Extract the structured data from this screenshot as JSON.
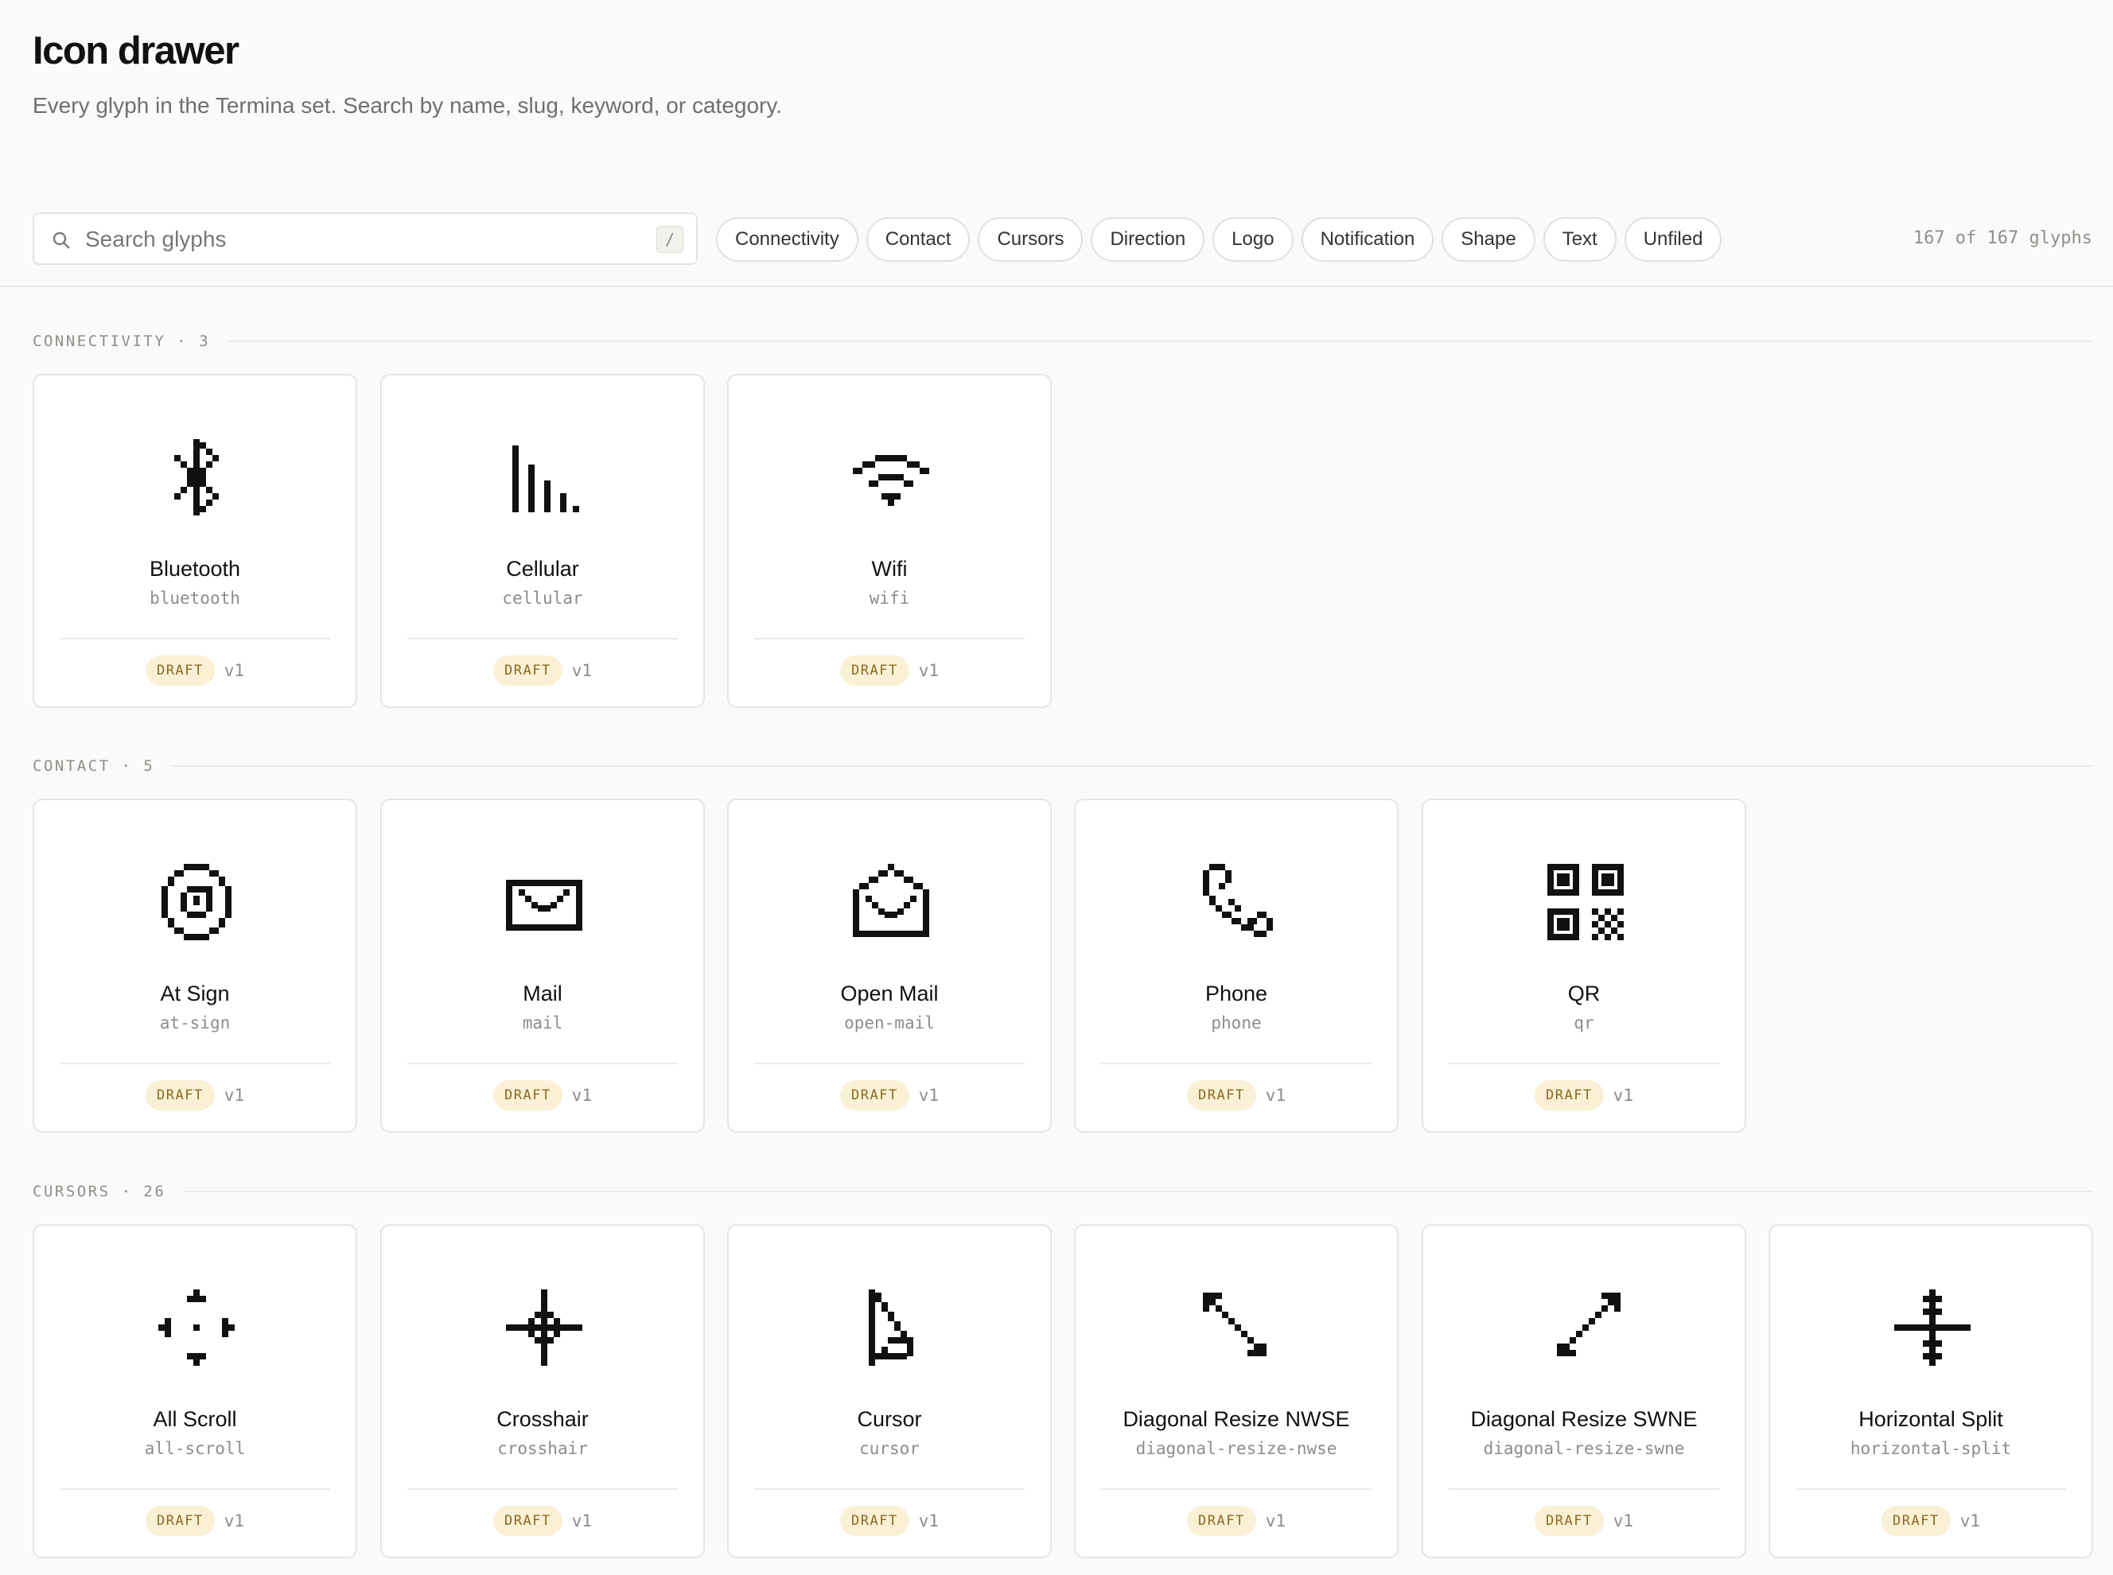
{
  "header": {
    "title": "Icon drawer",
    "subtitle": "Every glyph in the Termina set. Search by name, slug, keyword, or category."
  },
  "search": {
    "placeholder": "Search glyphs",
    "value": "",
    "shortcut": "/"
  },
  "filters": [
    "Connectivity",
    "Contact",
    "Cursors",
    "Direction",
    "Logo",
    "Notification",
    "Shape",
    "Text",
    "Unfiled"
  ],
  "count_label": "167 of 167 glyphs",
  "colors": {
    "background": "#fafaf8",
    "card": "#ffffff",
    "border": "#e6e5e1",
    "text": "#111111",
    "muted": "#8c8c89",
    "badge_bg": "#faf0d6",
    "badge_text": "#8a6a1c"
  },
  "sections": [
    {
      "title": "CONNECTIVITY · 3",
      "glyphs": [
        {
          "name": "Bluetooth",
          "slug": "bluetooth",
          "status": "DRAFT",
          "version": "v1",
          "icon": "bluetooth-icon"
        },
        {
          "name": "Cellular",
          "slug": "cellular",
          "status": "DRAFT",
          "version": "v1",
          "icon": "cellular-icon"
        },
        {
          "name": "Wifi",
          "slug": "wifi",
          "status": "DRAFT",
          "version": "v1",
          "icon": "wifi-icon"
        }
      ]
    },
    {
      "title": "CONTACT · 5",
      "glyphs": [
        {
          "name": "At Sign",
          "slug": "at-sign",
          "status": "DRAFT",
          "version": "v1",
          "icon": "at-sign-icon"
        },
        {
          "name": "Mail",
          "slug": "mail",
          "status": "DRAFT",
          "version": "v1",
          "icon": "mail-icon"
        },
        {
          "name": "Open Mail",
          "slug": "open-mail",
          "status": "DRAFT",
          "version": "v1",
          "icon": "open-mail-icon"
        },
        {
          "name": "Phone",
          "slug": "phone",
          "status": "DRAFT",
          "version": "v1",
          "icon": "phone-icon"
        },
        {
          "name": "QR",
          "slug": "qr",
          "status": "DRAFT",
          "version": "v1",
          "icon": "qr-icon"
        }
      ]
    },
    {
      "title": "CURSORS · 26",
      "glyphs": [
        {
          "name": "All Scroll",
          "slug": "all-scroll",
          "status": "DRAFT",
          "version": "v1",
          "icon": "all-scroll-icon"
        },
        {
          "name": "Crosshair",
          "slug": "crosshair",
          "status": "DRAFT",
          "version": "v1",
          "icon": "crosshair-icon"
        },
        {
          "name": "Cursor",
          "slug": "cursor",
          "status": "DRAFT",
          "version": "v1",
          "icon": "cursor-icon"
        },
        {
          "name": "Diagonal Resize NWSE",
          "slug": "diagonal-resize-nwse",
          "status": "DRAFT",
          "version": "v1",
          "icon": "diagonal-resize-nwse-icon"
        },
        {
          "name": "Diagonal Resize SWNE",
          "slug": "diagonal-resize-swne",
          "status": "DRAFT",
          "version": "v1",
          "icon": "diagonal-resize-swne-icon"
        },
        {
          "name": "Horizontal Split",
          "slug": "horizontal-split",
          "status": "DRAFT",
          "version": "v1",
          "icon": "horizontal-split-icon"
        }
      ]
    }
  ]
}
